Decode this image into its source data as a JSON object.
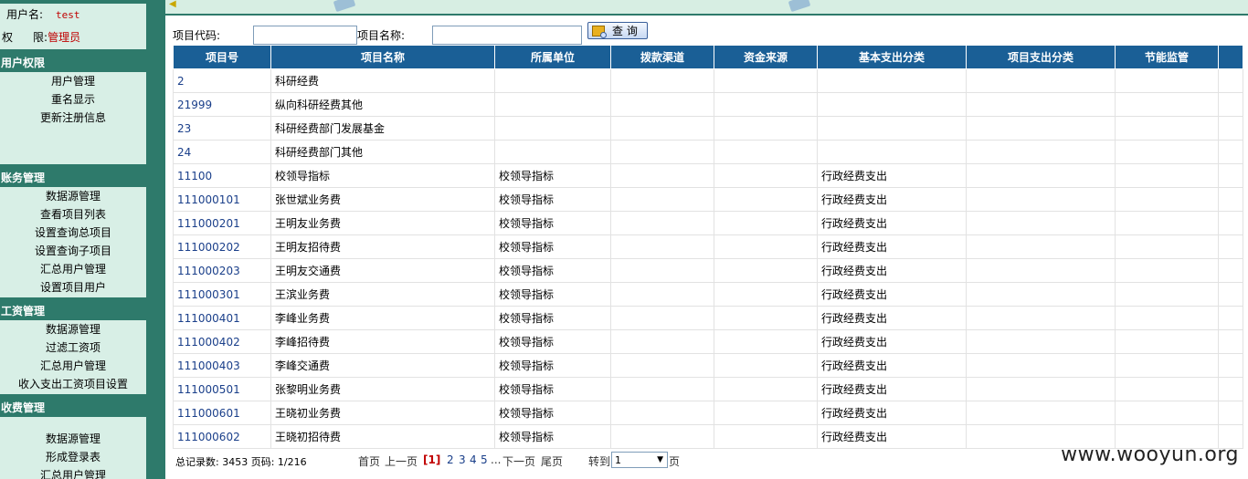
{
  "sidebar": {
    "user_label": "用户名:",
    "user_value": "test",
    "role_label_1": "权",
    "role_label_2": "限:",
    "role_value": "管理员",
    "sections": [
      {
        "title": "用户权限",
        "items": [
          "用户管理",
          "重名显示",
          "更新注册信息"
        ]
      },
      {
        "title": "账务管理",
        "items": [
          "数据源管理",
          "查看项目列表",
          "设置查询总项目",
          "设置查询子项目",
          "汇总用户管理",
          "设置项目用户"
        ]
      },
      {
        "title": "工资管理",
        "items": [
          "数据源管理",
          "过滤工资项",
          "汇总用户管理",
          "收入支出工资项目设置"
        ]
      },
      {
        "title": "收费管理",
        "items": [
          "数据源管理",
          "形成登录表",
          "汇总用户管理"
        ]
      }
    ]
  },
  "search": {
    "code_label": "项目代码:",
    "name_label": "项目名称:",
    "code_value": "",
    "name_value": "",
    "query_button": "查 询"
  },
  "table": {
    "headers": [
      "项目号",
      "项目名称",
      "所属单位",
      "拨款渠道",
      "资金来源",
      "基本支出分类",
      "项目支出分类",
      "节能监管",
      ""
    ],
    "rows": [
      [
        "2",
        "科研经费",
        "",
        "",
        "",
        "",
        "",
        "",
        ""
      ],
      [
        "21999",
        "纵向科研经费其他",
        "",
        "",
        "",
        "",
        "",
        "",
        ""
      ],
      [
        "23",
        "科研经费部门发展基金",
        "",
        "",
        "",
        "",
        "",
        "",
        ""
      ],
      [
        "24",
        "科研经费部门其他",
        "",
        "",
        "",
        "",
        "",
        "",
        ""
      ],
      [
        "11100",
        "校领导指标",
        "校领导指标",
        "",
        "",
        "行政经费支出",
        "",
        "",
        ""
      ],
      [
        "111000101",
        "张世斌业务费",
        "校领导指标",
        "",
        "",
        "行政经费支出",
        "",
        "",
        ""
      ],
      [
        "111000201",
        "王明友业务费",
        "校领导指标",
        "",
        "",
        "行政经费支出",
        "",
        "",
        ""
      ],
      [
        "111000202",
        "王明友招待费",
        "校领导指标",
        "",
        "",
        "行政经费支出",
        "",
        "",
        ""
      ],
      [
        "111000203",
        "王明友交通费",
        "校领导指标",
        "",
        "",
        "行政经费支出",
        "",
        "",
        ""
      ],
      [
        "111000301",
        "王滨业务费",
        "校领导指标",
        "",
        "",
        "行政经费支出",
        "",
        "",
        ""
      ],
      [
        "111000401",
        "李峰业务费",
        "校领导指标",
        "",
        "",
        "行政经费支出",
        "",
        "",
        ""
      ],
      [
        "111000402",
        "李峰招待费",
        "校领导指标",
        "",
        "",
        "行政经费支出",
        "",
        "",
        ""
      ],
      [
        "111000403",
        "李峰交通费",
        "校领导指标",
        "",
        "",
        "行政经费支出",
        "",
        "",
        ""
      ],
      [
        "111000501",
        "张黎明业务费",
        "校领导指标",
        "",
        "",
        "行政经费支出",
        "",
        "",
        ""
      ],
      [
        "111000601",
        "王晓初业务费",
        "校领导指标",
        "",
        "",
        "行政经费支出",
        "",
        "",
        ""
      ],
      [
        "111000602",
        "王晓初招待费",
        "校领导指标",
        "",
        "",
        "行政经费支出",
        "",
        "",
        ""
      ]
    ]
  },
  "pager": {
    "summary": "总记录数: 3453 页码: 1/216",
    "first": "首页",
    "prev": "上一页",
    "current": "[1]",
    "pages": [
      "2",
      "3",
      "4",
      "5"
    ],
    "ellipsis": "...",
    "next": "下一页",
    "last": "尾页",
    "goto_label": "转到",
    "goto_value": "1",
    "page_suffix": "页"
  },
  "watermark": "www.wooyun.org",
  "icons": {
    "query": "search-icon",
    "select_arrow": "chevron-down-icon"
  },
  "colors": {
    "sidebar_bg": "#2e7a6b",
    "panel_bg": "#d8efe6",
    "header_bg": "#1a5f96",
    "accent_red": "#c00000",
    "link_blue": "#1a3f8a"
  }
}
